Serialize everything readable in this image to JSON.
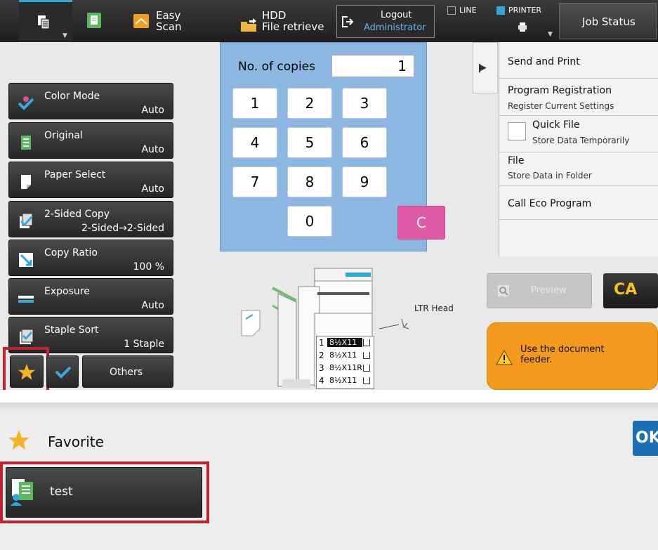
{
  "topbar": {
    "easy_scan": "Easy\nScan",
    "hdd": "HDD\nFile retrieve",
    "logout": "Logout",
    "user": "Administrator",
    "line": "LINE",
    "printer": "PRINTER",
    "job_status": "Job Status"
  },
  "copies": {
    "label": "No. of copies",
    "value": "1"
  },
  "keypad": {
    "keys": [
      "1",
      "2",
      "3",
      "4",
      "5",
      "6",
      "7",
      "8",
      "9",
      "0"
    ],
    "clear": "C"
  },
  "settings": [
    {
      "label": "Color Mode",
      "value": "Auto"
    },
    {
      "label": "Original",
      "value": "Auto"
    },
    {
      "label": "Paper Select",
      "value": "Auto"
    },
    {
      "label": "2-Sided Copy",
      "value": "2-Sided→2-Sided"
    },
    {
      "label": "Copy Ratio",
      "value": "100 %"
    },
    {
      "label": "Exposure",
      "value": "Auto"
    },
    {
      "label": "Staple Sort",
      "value": "1 Staple"
    }
  ],
  "bottom": {
    "others": "Others"
  },
  "right_list": {
    "send_print": "Send and Print",
    "program_registration": "Program Registration",
    "register_current": "Register Current Settings",
    "quick_file": "Quick File",
    "store_temp": "Store Data Temporarily",
    "file": "File",
    "store_folder": "Store Data in Folder",
    "call_eco": "Call Eco Program"
  },
  "preview": {
    "label": "Preview"
  },
  "ca": {
    "label": "CA"
  },
  "machine": {
    "ltr_head": "LTR Head",
    "trays": [
      {
        "n": "1",
        "size": "8½X11"
      },
      {
        "n": "2",
        "size": "8½X11"
      },
      {
        "n": "3",
        "size": "8½X11R"
      },
      {
        "n": "4",
        "size": "8½X11"
      }
    ]
  },
  "alert": {
    "text": "Use the document\nfeeder."
  },
  "favorite": {
    "title": "Favorite",
    "ok": "OK",
    "items": [
      "test"
    ]
  },
  "colors": {
    "keypad_bg": "#8cb7e3",
    "clear_key": "#e15aa6",
    "alert_bg": "#f39a1e",
    "highlight": "#c0222e",
    "ok_bg": "#1a6fb5",
    "ca_text": "#f3c21b"
  }
}
